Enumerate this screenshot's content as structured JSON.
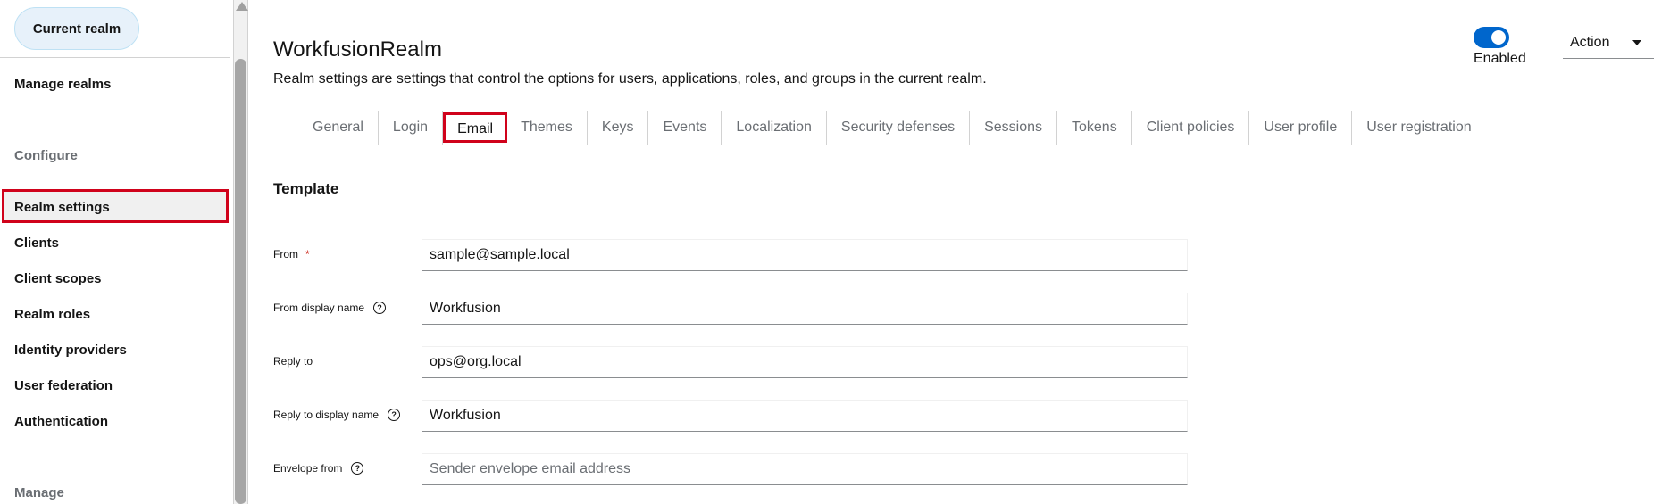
{
  "sidebar": {
    "realm_selector": "Current realm",
    "manage_realms": "Manage realms",
    "configure_section": "Configure",
    "items": [
      {
        "label": "Realm settings"
      },
      {
        "label": "Clients"
      },
      {
        "label": "Client scopes"
      },
      {
        "label": "Realm roles"
      },
      {
        "label": "Identity providers"
      },
      {
        "label": "User federation"
      },
      {
        "label": "Authentication"
      }
    ],
    "manage_section": "Manage"
  },
  "header": {
    "title": "WorkfusionRealm",
    "description": "Realm settings are settings that control the options for users, applications, roles, and groups in the current realm.",
    "enabled_label": "Enabled",
    "enabled": true,
    "action_label": "Action"
  },
  "tabs": [
    {
      "label": "General"
    },
    {
      "label": "Login"
    },
    {
      "label": "Email",
      "active": true
    },
    {
      "label": "Themes"
    },
    {
      "label": "Keys"
    },
    {
      "label": "Events"
    },
    {
      "label": "Localization"
    },
    {
      "label": "Security defenses"
    },
    {
      "label": "Sessions"
    },
    {
      "label": "Tokens"
    },
    {
      "label": "Client policies"
    },
    {
      "label": "User profile"
    },
    {
      "label": "User registration"
    }
  ],
  "template_section": {
    "title": "Template",
    "fields": [
      {
        "label": "From",
        "required_mark": "*",
        "value": "sample@sample.local",
        "placeholder": ""
      },
      {
        "label": "From display name",
        "value": "Workfusion",
        "placeholder": ""
      },
      {
        "label": "Reply to",
        "value": "ops@org.local",
        "placeholder": ""
      },
      {
        "label": "Reply to display name",
        "value": "Workfusion",
        "placeholder": ""
      },
      {
        "label": "Envelope from",
        "value": "",
        "placeholder": "Sender envelope email address"
      }
    ]
  },
  "colors": {
    "accent": "#0066cc",
    "highlight": "#d0021b",
    "required": "#c9190b"
  }
}
